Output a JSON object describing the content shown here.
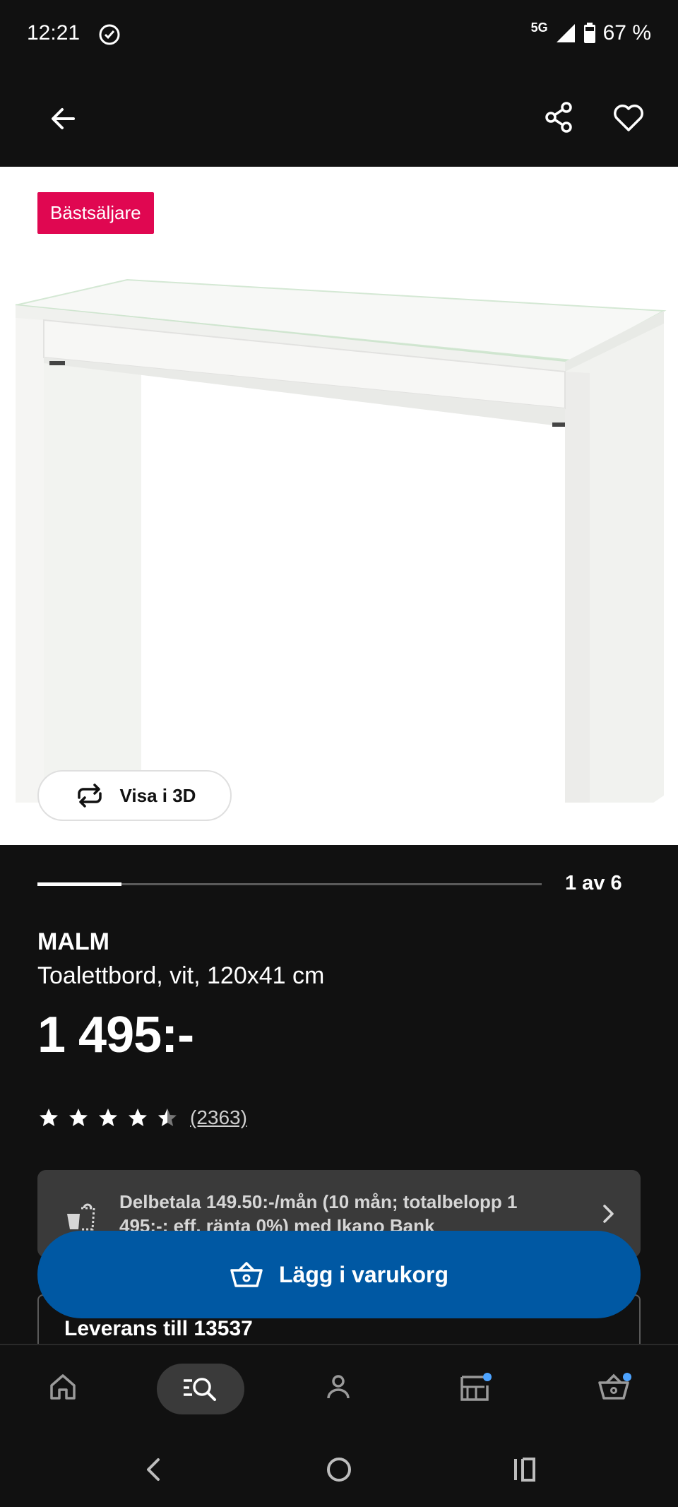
{
  "status_bar": {
    "time": "12:21",
    "network": "5G",
    "battery": "67 %"
  },
  "product": {
    "badge": "Bästsäljare",
    "view_3d_label": "Visa i 3D",
    "image_pager": {
      "label": "1 av 6",
      "current": 1,
      "total": 6
    },
    "brand": "MALM",
    "description": "Toalettbord, vit, 120x41 cm",
    "price": "1 495:-",
    "rating": {
      "value": 4.5,
      "max": 5,
      "count_label": "(2363)"
    }
  },
  "financing": {
    "text": "Delbetala 149.50:-/mån (10 mån; totalbelopp 1 495:-; eff. ränta 0%) med Ikano Bank"
  },
  "delivery": {
    "label": "Leverans till 13537"
  },
  "cart_button": {
    "label": "Lägg i varukorg"
  },
  "bottom_nav": {
    "items": [
      "home-icon",
      "search-icon",
      "profile-icon",
      "store-icon",
      "cart-icon"
    ],
    "active": "search-icon"
  },
  "colors": {
    "background": "#111111",
    "badge": "#e00751",
    "cart_button": "#0058a3",
    "notification_dot": "#4da3ff"
  }
}
